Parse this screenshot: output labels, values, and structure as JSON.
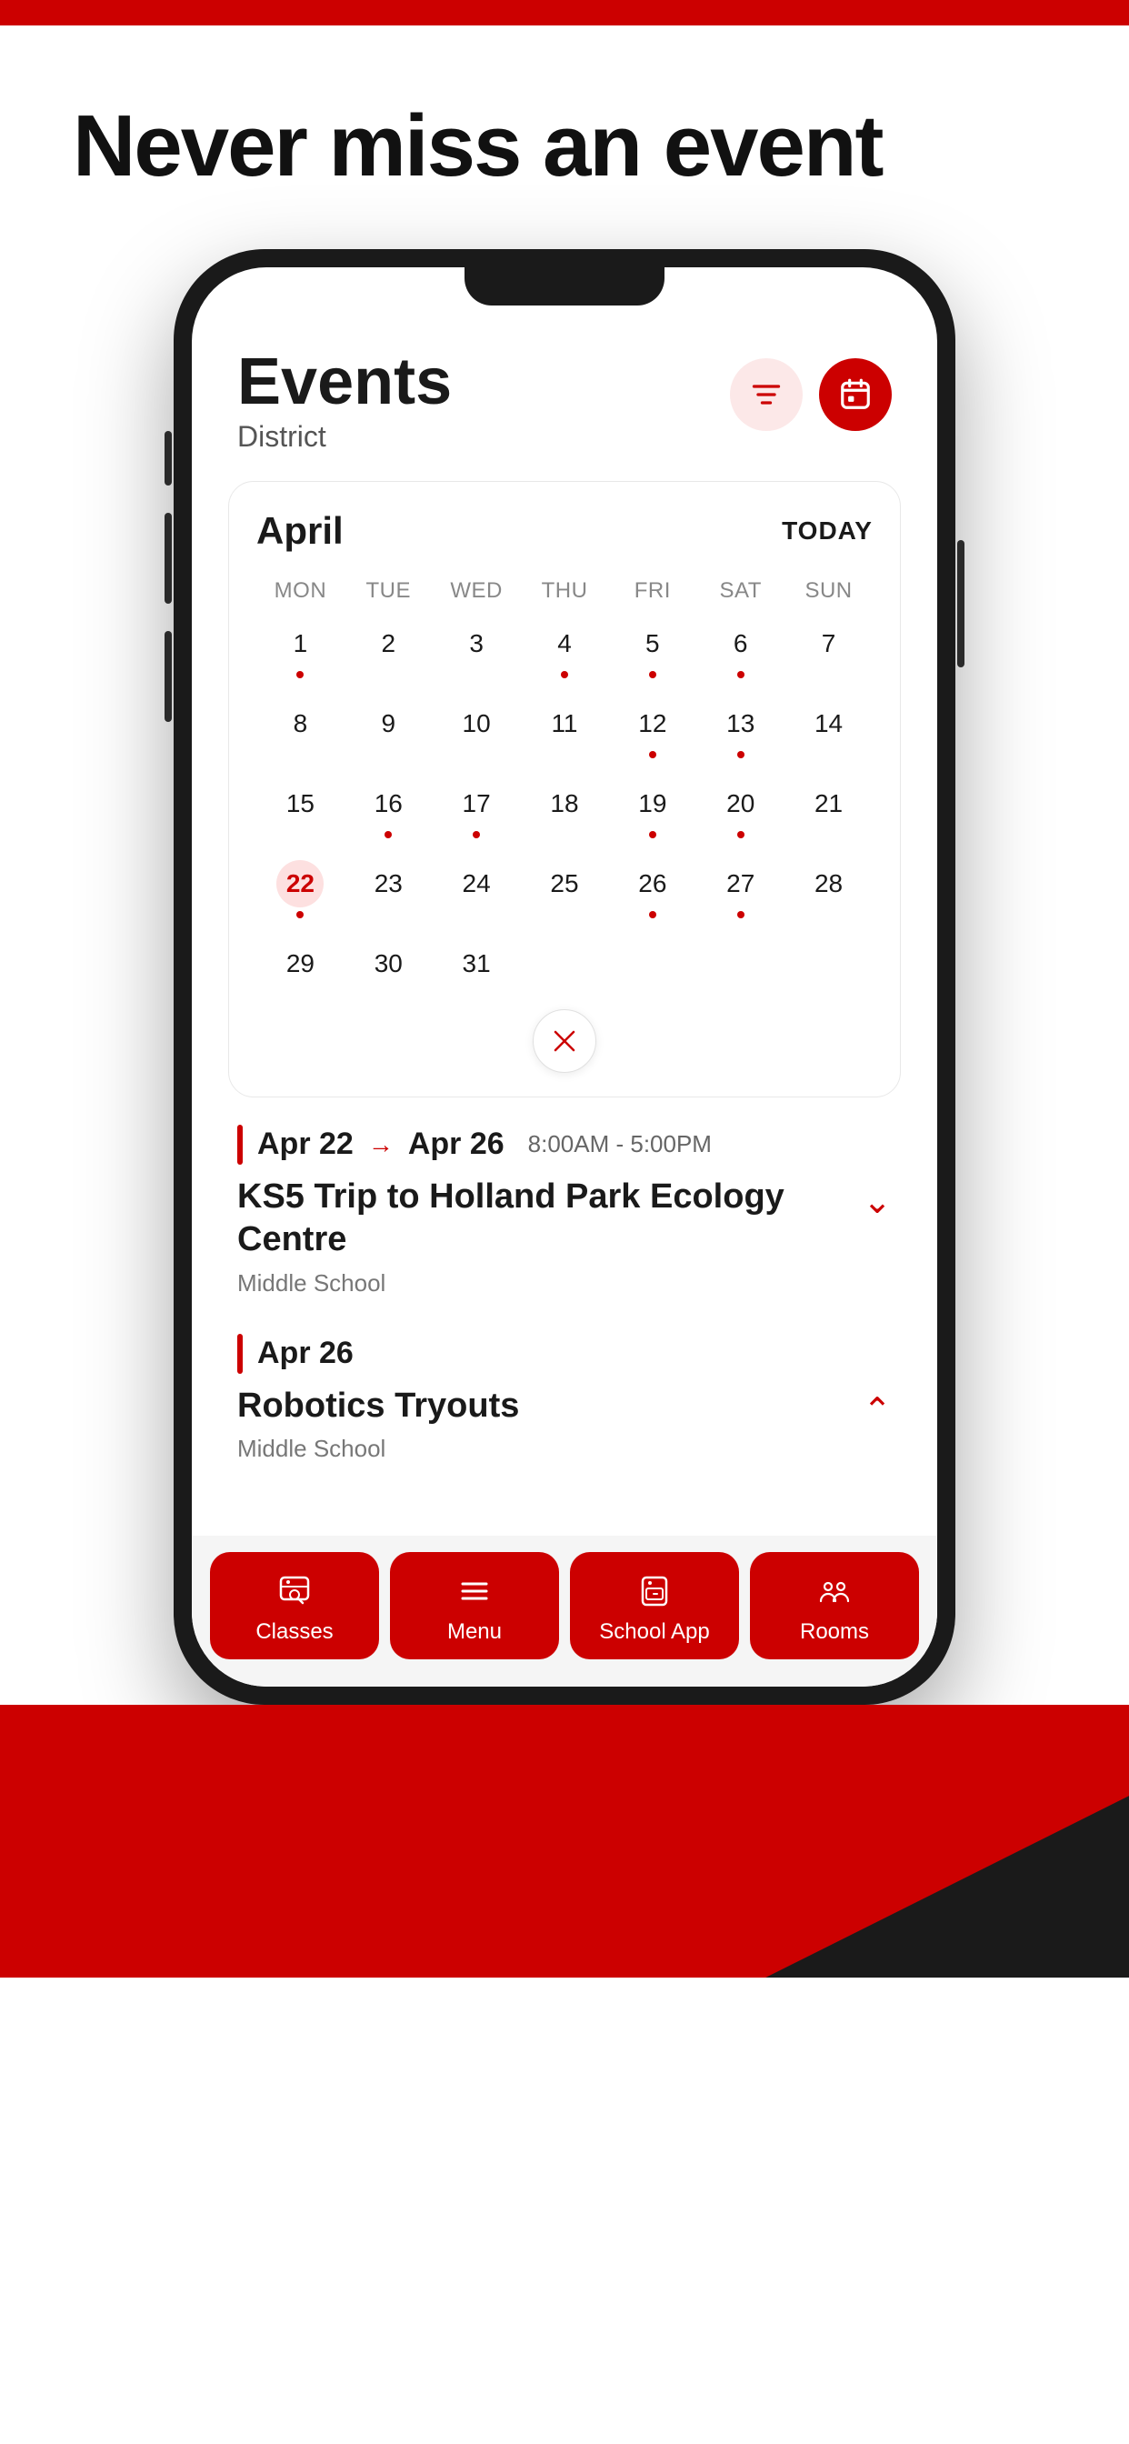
{
  "topBar": {
    "color": "#cc0000"
  },
  "headline": {
    "text": "Never miss an event"
  },
  "phone": {
    "screen": {
      "eventsTitle": "Events",
      "eventsSubtitle": "District",
      "filterBtnLabel": "filter",
      "calendarBtnLabel": "calendar",
      "calendar": {
        "month": "April",
        "todayLabel": "TODAY",
        "dayHeaders": [
          "MON",
          "TUE",
          "WED",
          "THU",
          "FRI",
          "SAT",
          "SUN"
        ],
        "weeks": [
          [
            {
              "num": "1",
              "dot": true,
              "today": false
            },
            {
              "num": "2",
              "dot": false,
              "today": false
            },
            {
              "num": "3",
              "dot": false,
              "today": false
            },
            {
              "num": "4",
              "dot": true,
              "today": false
            },
            {
              "num": "5",
              "dot": true,
              "today": false
            },
            {
              "num": "6",
              "dot": true,
              "today": false
            },
            {
              "num": "7",
              "dot": false,
              "today": false
            }
          ],
          [
            {
              "num": "8",
              "dot": false,
              "today": false
            },
            {
              "num": "9",
              "dot": false,
              "today": false
            },
            {
              "num": "10",
              "dot": false,
              "today": false
            },
            {
              "num": "11",
              "dot": false,
              "today": false
            },
            {
              "num": "12",
              "dot": true,
              "today": false
            },
            {
              "num": "13",
              "dot": true,
              "today": false
            },
            {
              "num": "14",
              "dot": false,
              "today": false
            }
          ],
          [
            {
              "num": "15",
              "dot": false,
              "today": false
            },
            {
              "num": "16",
              "dot": true,
              "today": false
            },
            {
              "num": "17",
              "dot": true,
              "today": false
            },
            {
              "num": "18",
              "dot": false,
              "today": false
            },
            {
              "num": "19",
              "dot": true,
              "today": false
            },
            {
              "num": "20",
              "dot": true,
              "today": false
            },
            {
              "num": "21",
              "dot": false,
              "today": false
            }
          ],
          [
            {
              "num": "22",
              "dot": true,
              "today": true
            },
            {
              "num": "23",
              "dot": false,
              "today": false
            },
            {
              "num": "24",
              "dot": false,
              "today": false
            },
            {
              "num": "25",
              "dot": false,
              "today": false
            },
            {
              "num": "26",
              "dot": true,
              "today": false
            },
            {
              "num": "27",
              "dot": true,
              "today": false
            },
            {
              "num": "28",
              "dot": false,
              "today": false
            }
          ],
          [
            {
              "num": "29",
              "dot": false,
              "today": false
            },
            {
              "num": "30",
              "dot": false,
              "today": false
            },
            {
              "num": "31",
              "dot": false,
              "today": false
            },
            {
              "num": "",
              "dot": false,
              "today": false
            },
            {
              "num": "",
              "dot": false,
              "today": false
            },
            {
              "num": "",
              "dot": false,
              "today": false
            },
            {
              "num": "",
              "dot": false,
              "today": false
            }
          ]
        ]
      },
      "events": [
        {
          "dateFrom": "Apr 22",
          "dateTo": "Apr 26",
          "hasRange": true,
          "time": "8:00AM  -  5:00PM",
          "title": "KS5 Trip to Holland Park Ecology Centre",
          "school": "Middle School",
          "chevronDown": true
        },
        {
          "dateFrom": "Apr 26",
          "dateTo": "",
          "hasRange": false,
          "time": "",
          "title": "Robotics Tryouts",
          "school": "Middle School",
          "chevronDown": false
        }
      ],
      "bottomNav": [
        {
          "label": "Classes",
          "icon": "classes-icon"
        },
        {
          "label": "Menu",
          "icon": "menu-icon"
        },
        {
          "label": "School App",
          "icon": "school-app-icon"
        },
        {
          "label": "Rooms",
          "icon": "rooms-icon"
        }
      ]
    }
  }
}
